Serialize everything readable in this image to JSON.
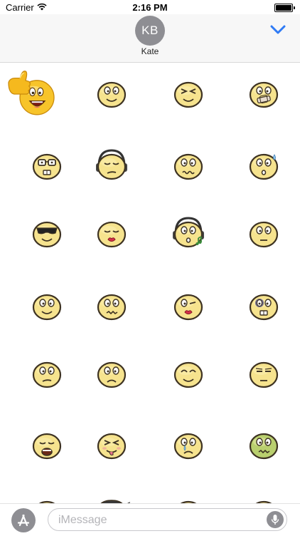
{
  "status_bar": {
    "carrier": "Carrier",
    "time": "2:16 PM"
  },
  "header": {
    "avatar_initials": "KB",
    "contact_name": "Kate",
    "accent_color": "#2f7bf5",
    "avatar_color": "#8e8e93"
  },
  "stickers": [
    {
      "name": "thumbs-up-laughing-emoji"
    },
    {
      "name": "smiling-emoji"
    },
    {
      "name": "squinting-grin-emoji"
    },
    {
      "name": "bandaged-mouth-emoji"
    },
    {
      "name": "nerd-glasses-emoji"
    },
    {
      "name": "headphones-relaxed-emoji"
    },
    {
      "name": "worried-wavy-mouth-emoji"
    },
    {
      "name": "sweating-surprised-emoji"
    },
    {
      "name": "sunglasses-cool-emoji"
    },
    {
      "name": "kissing-lips-emoji"
    },
    {
      "name": "headphones-music-notes-emoji"
    },
    {
      "name": "neutral-face-emoji"
    },
    {
      "name": "surprised-face-emoji"
    },
    {
      "name": "thinking-face-emoji"
    },
    {
      "name": "winking-lips-emoji"
    },
    {
      "name": "bruised-eye-emoji"
    },
    {
      "name": "confused-face-emoji"
    },
    {
      "name": "disappointed-face-emoji"
    },
    {
      "name": "content-closed-eyes-emoji"
    },
    {
      "name": "unamused-flat-emoji"
    },
    {
      "name": "yelling-open-mouth-emoji"
    },
    {
      "name": "silly-tongue-emoji"
    },
    {
      "name": "crying-tear-emoji"
    },
    {
      "name": "sick-green-emoji"
    },
    {
      "name": "dizzy-face-emoji"
    },
    {
      "name": "ninja-emoji"
    },
    {
      "name": "angry-squint-emoji"
    },
    {
      "name": "shocked-face-emoji"
    }
  ],
  "composer": {
    "placeholder": "iMessage",
    "value": ""
  },
  "icons": {
    "wifi": "wifi-icon",
    "battery": "battery-icon",
    "collapse": "chevron-down-icon",
    "app_store": "app-store-icon",
    "microphone": "microphone-icon"
  }
}
